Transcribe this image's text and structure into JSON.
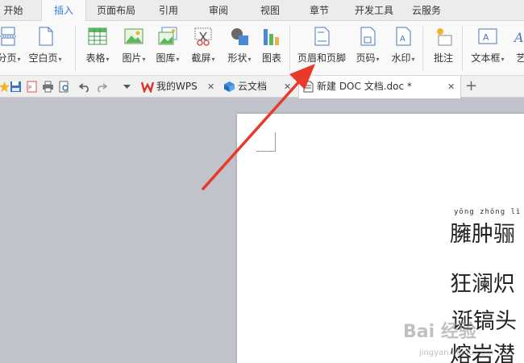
{
  "ribbon_tabs": [
    "开始",
    "插入",
    "页面布局",
    "引用",
    "审阅",
    "视图",
    "章节",
    "开发工具",
    "云服务"
  ],
  "active_ribbon_tab": "插入",
  "ribbon_buttons": {
    "page_break": "分页",
    "blank_page": "空白页",
    "table": "表格",
    "picture": "图片",
    "gallery": "图库",
    "screenshot": "截屏",
    "shapes": "形状",
    "chart": "图表",
    "header_footer": "页眉和页脚",
    "page_number": "页码",
    "watermark": "水印",
    "comment": "批注",
    "textbox": "文本框",
    "art_text": "艺"
  },
  "doc_tabs": {
    "wps": "我的WPS",
    "cloud": "云文档",
    "current": "新建 DOC 文档.doc *"
  },
  "document": {
    "pinyin": "yōng zhǒng  lì",
    "lines": [
      "臃肿骊",
      "狂澜炽",
      "诞镐头",
      "熔岩潜"
    ]
  },
  "overlay": {
    "watermark": "Bai 经验",
    "watermark_url": "jingyan.baidu.com"
  },
  "colors": {
    "accent": "#2f7ed8",
    "arrow": "#e8392b",
    "workspace": "#c1c3ca"
  }
}
